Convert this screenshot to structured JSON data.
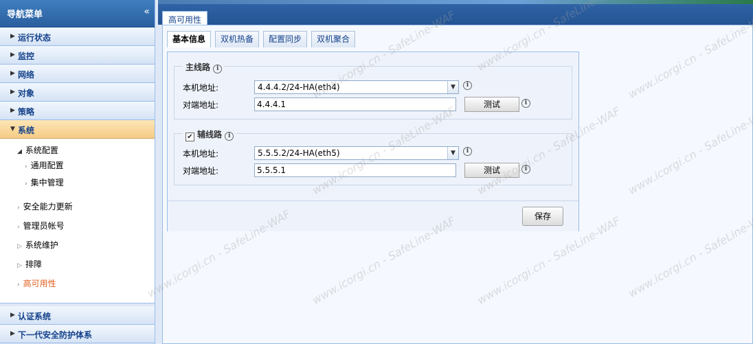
{
  "sidebar": {
    "title": "导航菜单",
    "collapse_icon": "«",
    "items_top": [
      {
        "label": "运行状态"
      },
      {
        "label": "监控"
      },
      {
        "label": "网络"
      },
      {
        "label": "对象"
      },
      {
        "label": "策略"
      }
    ],
    "active_item": {
      "label": "系统"
    },
    "submenu": {
      "group_label": "系统配置",
      "group_children": [
        "通用配置",
        "集中管理"
      ],
      "others": [
        "安全能力更新",
        "管理员帐号",
        "系统维护",
        "排障",
        "高可用性"
      ]
    },
    "items_bottom": [
      {
        "label": "认证系统"
      },
      {
        "label": "下一代安全防护体系"
      }
    ]
  },
  "main": {
    "tab_label": "高可用性",
    "subtabs": [
      "基本信息",
      "双机热备",
      "配置同步",
      "双机聚合"
    ],
    "primary": {
      "legend": "主线路",
      "local_label": "本机地址:",
      "local_value": "4.4.4.2/24-HA(eth4)",
      "peer_label": "对端地址:",
      "peer_value": "4.4.4.1",
      "test_label": "测试"
    },
    "secondary": {
      "legend": "辅线路",
      "checked": true,
      "local_label": "本机地址:",
      "local_value": "5.5.5.2/24-HA(eth5)",
      "peer_label": "对端地址:",
      "peer_value": "5.5.5.1",
      "test_label": "测试"
    },
    "save_label": "保存"
  },
  "watermark_text": "www.icorgi.cn - SafeLine-WAF",
  "icons": {
    "info": "i",
    "dropdown": "▼",
    "check": "✔",
    "arrow_right": "▶",
    "arrow_down": "▼"
  }
}
